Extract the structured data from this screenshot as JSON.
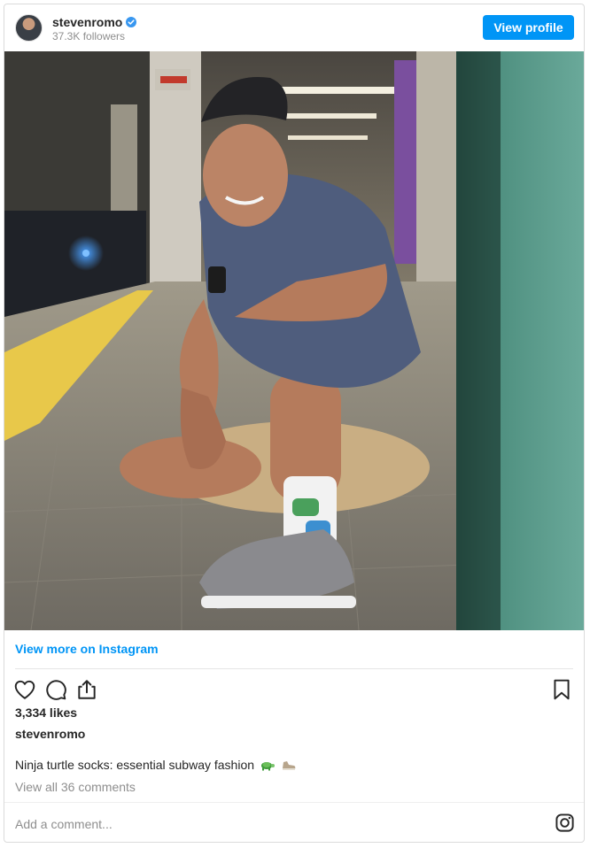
{
  "header": {
    "username": "stevenromo",
    "followers": "37.3K followers",
    "view_profile_label": "View profile"
  },
  "post": {
    "view_more_label": "View more on Instagram",
    "likes": "3,334 likes",
    "caption_username": "stevenromo",
    "caption_text": "Ninja turtle socks: essential subway fashion",
    "caption_emojis": [
      "turtle",
      "sneaker"
    ],
    "view_comments_label": "View all 36 comments",
    "add_comment_placeholder": "Add a comment..."
  },
  "icons": {
    "verified": "verified-badge-icon",
    "like": "heart-icon",
    "comment": "comment-icon",
    "share": "share-icon",
    "save": "bookmark-icon",
    "brand": "instagram-icon"
  },
  "colors": {
    "accent": "#0095f6",
    "text": "#262626",
    "muted": "#8e8e8e"
  }
}
